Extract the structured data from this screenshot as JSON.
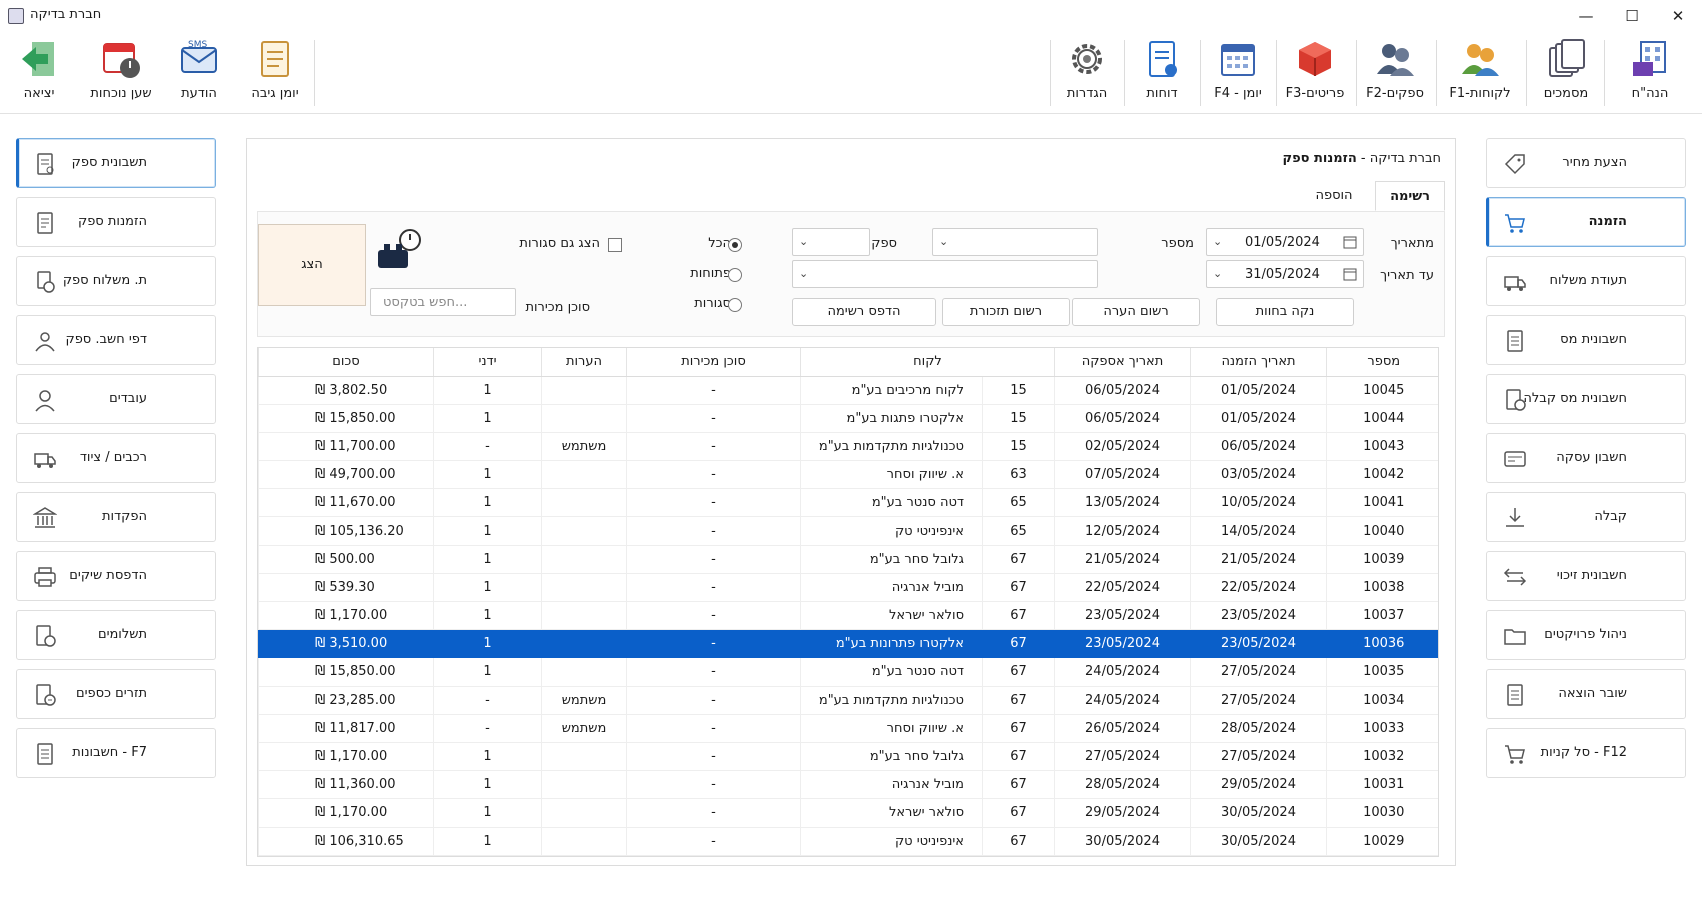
{
  "window": {
    "title": "חברת בדיקה"
  },
  "toolbar": {
    "left": [
      {
        "label": "יציאה",
        "icon": "exit-arrow-icon"
      },
      {
        "label": "שען נוכחות",
        "icon": "time-clock-icon"
      },
      {
        "label": "הודעת",
        "icon": "sms-message-icon"
      },
      {
        "label": "יומן גיבה",
        "icon": "backup-log-icon"
      }
    ],
    "right": [
      {
        "label": "הגדרות",
        "icon": "gear-icon"
      },
      {
        "label": "דוחות",
        "icon": "report-icon"
      },
      {
        "label": "F4 - יומן",
        "icon": "calendar-icon"
      },
      {
        "label": "F3-פריטים",
        "icon": "items-box-icon"
      },
      {
        "label": "F2-ספקים",
        "icon": "suppliers-icon"
      },
      {
        "label": "F1-לקוחות",
        "icon": "customers-icon"
      },
      {
        "label": "מסמכים",
        "icon": "documents-icon"
      },
      {
        "label": "הנה\"ח",
        "icon": "accounting-building-icon"
      }
    ]
  },
  "left_sidebar": [
    {
      "label": "תשבונית ספק",
      "icon": "invoice-icon",
      "active": true
    },
    {
      "label": "הזמנות ספק",
      "icon": "order-doc-icon",
      "active": false
    },
    {
      "label": "ת. משלוח ספק",
      "icon": "delivery-doc-icon",
      "active": false
    },
    {
      "label": "דפי חשב. ספק",
      "icon": "supplier-account-icon",
      "active": false
    },
    {
      "label": "עובדים",
      "icon": "employee-icon",
      "active": false
    },
    {
      "label": "רכבים / ציוד",
      "icon": "truck-icon",
      "active": false
    },
    {
      "label": "הפקדות",
      "icon": "bank-icon",
      "active": false
    },
    {
      "label": "הדפסת שיקים",
      "icon": "printer-icon",
      "active": false
    },
    {
      "label": "תשלומים",
      "icon": "payment-doc-icon",
      "active": false
    },
    {
      "label": "תזרים כספים",
      "icon": "cashflow-icon",
      "active": false
    },
    {
      "label": "F7 - חשבונות",
      "icon": "accounts-doc-icon",
      "active": false
    }
  ],
  "right_sidebar": [
    {
      "label": "הצעת מחיר",
      "icon": "price-tag-icon",
      "active": false
    },
    {
      "label": "הזמנה",
      "icon": "shopping-cart-icon",
      "active": true
    },
    {
      "label": "תעודת משלוח",
      "icon": "delivery-truck-icon",
      "active": false
    },
    {
      "label": "חשבונית מס",
      "icon": "tax-invoice-icon",
      "active": false
    },
    {
      "label": "חשבונית מס קבלה",
      "icon": "tax-receipt-icon",
      "active": false
    },
    {
      "label": "חשבון עסקה",
      "icon": "deal-account-icon",
      "active": false
    },
    {
      "label": "קבלה",
      "icon": "receipt-download-icon",
      "active": false
    },
    {
      "label": "חשבונית זיכוי",
      "icon": "credit-arrows-icon",
      "active": false
    },
    {
      "label": "ניהול פרויקטים",
      "icon": "folder-icon",
      "active": false
    },
    {
      "label": "שובר הוצאה",
      "icon": "expense-voucher-icon",
      "active": false
    },
    {
      "label": "F12 - סל קניות",
      "icon": "cart-icon",
      "active": false
    }
  ],
  "panel": {
    "title_company": "חברת בדיקה -",
    "title_page": "הזמנות ספק",
    "tabs": [
      {
        "label": "רשימה",
        "active": true
      },
      {
        "label": "הוספה",
        "active": false
      }
    ]
  },
  "filters": {
    "from_date_label": "מתאריך",
    "from_date_value": "01/05/2024",
    "to_date_label": "עד תאריך",
    "to_date_value": "31/05/2024",
    "number_label": "מספר",
    "supplier_label": "ספק",
    "radio_all": "הכל",
    "radio_open": "פתוחות",
    "radio_closed": "סגורות",
    "show_closed_label": "הצג גם סגורות",
    "agent_label": "סוכן מכירות",
    "search_placeholder": "חפש בטקסט...",
    "show_button": "הצג",
    "btn_clean_marks": "נקה בחוות",
    "btn_register_note": "רשום הערה",
    "btn_register_reminder": "רשום תזכורת",
    "btn_print_list": "הדפס רשימה"
  },
  "table": {
    "headers": [
      "מספר",
      "תאריך הזמנה",
      "תאריך אספקה",
      "לקוח",
      "סוכן מכירות",
      "הערות",
      "ידני",
      "סכום"
    ],
    "rows": [
      [
        "10045",
        "01/05/2024",
        "06/05/2024",
        "15",
        "לקוח מרכיבים בע\"מ",
        "-",
        "",
        "1",
        "₪ 3,802.50"
      ],
      [
        "10044",
        "01/05/2024",
        "06/05/2024",
        "15",
        "אלקטרו פתגות בע\"מ",
        "-",
        "",
        "1",
        "₪ 15,850.00"
      ],
      [
        "10043",
        "06/05/2024",
        "02/05/2024",
        "15",
        "טכנולגיות מתקדמות בע\"מ",
        "-",
        "משתמש",
        "-",
        "₪ 11,700.00"
      ],
      [
        "10042",
        "03/05/2024",
        "07/05/2024",
        "63",
        "א. שיווק וסחר",
        "-",
        "",
        "1",
        "₪ 49,700.00"
      ],
      [
        "10041",
        "10/05/2024",
        "13/05/2024",
        "65",
        "דטה סנטר בע\"מ",
        "-",
        "",
        "1",
        "₪ 11,670.00"
      ],
      [
        "10040",
        "14/05/2024",
        "12/05/2024",
        "65",
        "אינפיניטי טק",
        "-",
        "",
        "1",
        "₪ 105,136.20"
      ],
      [
        "10039",
        "21/05/2024",
        "21/05/2024",
        "67",
        "גלובל סחר בע\"מ",
        "-",
        "",
        "1",
        "₪ 500.00"
      ],
      [
        "10038",
        "22/05/2024",
        "22/05/2024",
        "67",
        "מוביל אנרגיה",
        "-",
        "",
        "1",
        "₪ 539.30"
      ],
      [
        "10037",
        "23/05/2024",
        "23/05/2024",
        "67",
        "סולאר ישראל",
        "-",
        "",
        "1",
        "₪ 1,170.00"
      ],
      [
        "10036",
        "23/05/2024",
        "23/05/2024",
        "67",
        "אלקטרו פתרונות בע\"מ",
        "-",
        "",
        "1",
        "₪ 3,510.00"
      ],
      [
        "10035",
        "27/05/2024",
        "24/05/2024",
        "67",
        "דטה סנטר בע\"מ",
        "-",
        "",
        "1",
        "₪ 15,850.00"
      ],
      [
        "10034",
        "27/05/2024",
        "24/05/2024",
        "67",
        "טכנולגיות מתקדמות בע\"מ",
        "-",
        "משתמש",
        "-",
        "₪ 23,285.00"
      ],
      [
        "10033",
        "28/05/2024",
        "26/05/2024",
        "67",
        "א. שיווק וסחר",
        "-",
        "משתמש",
        "-",
        "₪ 11,817.00"
      ],
      [
        "10032",
        "27/05/2024",
        "27/05/2024",
        "67",
        "גלובל סחר בע\"מ",
        "-",
        "",
        "1",
        "₪ 1,170.00"
      ],
      [
        "10031",
        "29/05/2024",
        "28/05/2024",
        "67",
        "מוביל אנרגיה",
        "-",
        "",
        "1",
        "₪ 11,360.00"
      ],
      [
        "10030",
        "30/05/2024",
        "29/05/2024",
        "67",
        "סולאר ישראל",
        "-",
        "",
        "1",
        "₪ 1,170.00"
      ],
      [
        "10029",
        "30/05/2024",
        "30/05/2024",
        "67",
        "אינפיניטי טק",
        "-",
        "",
        "1",
        "₪ 106,310.65"
      ]
    ],
    "selected_row": 9
  },
  "colors": {
    "selection": "#0a5fc9",
    "show_button_bg": "#fdf3e8",
    "accent": "#1e6fc9"
  }
}
